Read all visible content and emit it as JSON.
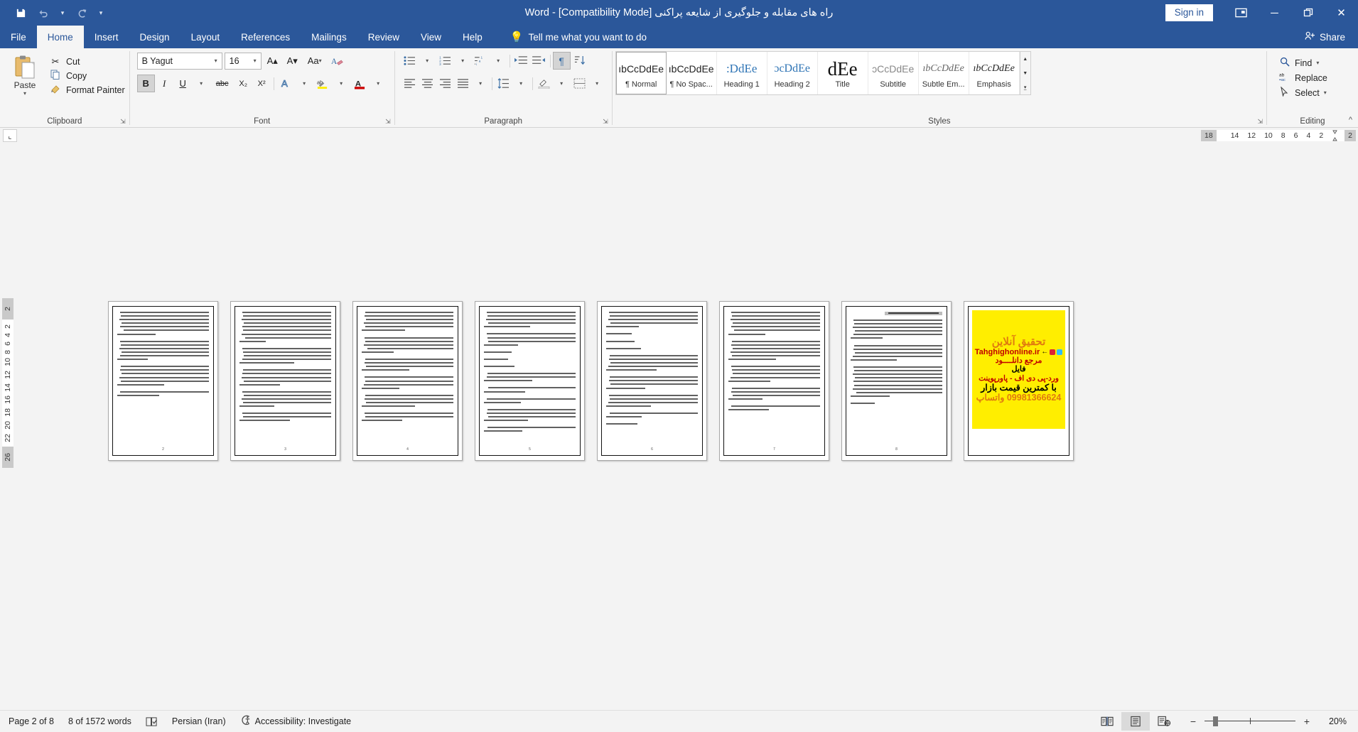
{
  "titlebar": {
    "document_title": "راه های مقابله و جلوگیری  از شایعه پراکنی [Compatibility Mode]  -  Word",
    "save_icon": "save-icon",
    "undo_icon": "undo-icon",
    "redo_icon": "redo-icon",
    "customize_icon": "customize-quick-access-toolbar-icon",
    "sign_in": "Sign in",
    "ribbon_display_icon": "ribbon-display-options-icon",
    "minimize": "─",
    "restore": "❐",
    "close": "✕"
  },
  "tabs": [
    {
      "label": "File",
      "active": false
    },
    {
      "label": "Home",
      "active": true
    },
    {
      "label": "Insert",
      "active": false
    },
    {
      "label": "Design",
      "active": false
    },
    {
      "label": "Layout",
      "active": false
    },
    {
      "label": "References",
      "active": false
    },
    {
      "label": "Mailings",
      "active": false
    },
    {
      "label": "Review",
      "active": false
    },
    {
      "label": "View",
      "active": false
    },
    {
      "label": "Help",
      "active": false
    }
  ],
  "tell_me": {
    "label": "Tell me what you want to do",
    "icon": "lightbulb-icon"
  },
  "share": {
    "label": "Share",
    "icon": "share-person-icon"
  },
  "ribbon": {
    "clipboard": {
      "group_label": "Clipboard",
      "paste_label": "Paste",
      "items": [
        {
          "label": "Cut",
          "icon": "scissors-icon"
        },
        {
          "label": "Copy",
          "icon": "copy-icon"
        },
        {
          "label": "Format Painter",
          "icon": "format-painter-icon"
        }
      ]
    },
    "font": {
      "group_label": "Font",
      "font_name": "B Yagut",
      "font_size": "16",
      "grow_font": "A▴",
      "shrink_font": "A▾",
      "change_case": "Aa",
      "clear_formatting": "clear-formatting-icon",
      "bold": "B",
      "italic": "I",
      "underline": "U",
      "strikethrough": "abc",
      "subscript": "X₂",
      "superscript": "X²",
      "text_effects": "A",
      "highlight": "ab",
      "font_color": "A"
    },
    "paragraph": {
      "group_label": "Paragraph",
      "bullets": "bullet-list-icon",
      "numbering": "numbered-list-icon",
      "multilevel": "multilevel-list-icon",
      "decrease_indent": "decrease-indent-icon",
      "increase_indent": "increase-indent-icon",
      "rtl_text": "right-to-left-text-icon",
      "sort": "sort-icon",
      "show_marks": "¶",
      "align_left": "align-left-icon",
      "align_center": "align-center-icon",
      "align_right": "align-right-icon",
      "justify": "justify-icon",
      "line_spacing": "line-spacing-icon",
      "shading": "shading-icon",
      "borders": "borders-icon"
    },
    "styles": {
      "group_label": "Styles",
      "items": [
        {
          "preview": "ıbCcDdEe",
          "name": "¶ Normal",
          "selected": true
        },
        {
          "preview": "ıbCcDdEe",
          "name": "¶ No Spac...",
          "selected": false
        },
        {
          "preview": ":DdEe",
          "name": "Heading 1",
          "selected": false
        },
        {
          "preview": "ɔcDdEe",
          "name": "Heading 2",
          "selected": false
        },
        {
          "preview": "dEe",
          "name": "Title",
          "selected": false
        },
        {
          "preview": "ɔCcDdEe",
          "name": "Subtitle",
          "selected": false
        },
        {
          "preview": "ıbCcDdEe",
          "name": "Subtle Em...",
          "selected": false
        },
        {
          "preview": "ıbCcDdEe",
          "name": "Emphasis",
          "selected": false
        }
      ]
    },
    "editing": {
      "group_label": "Editing",
      "items": [
        {
          "label": "Find",
          "icon": "magnifier-icon",
          "has_caret": true
        },
        {
          "label": "Replace",
          "icon": "replace-icon",
          "has_caret": false
        },
        {
          "label": "Select",
          "icon": "select-cursor-icon",
          "has_caret": true
        }
      ]
    },
    "collapse_icon": "collapse-ribbon-caret-icon"
  },
  "rulers": {
    "tab_stop_selector": "tab-stop-selector",
    "horizontal_grey_left": "18",
    "horizontal_numbers": [
      "14",
      "12",
      "10",
      "8",
      "6",
      "4",
      "2"
    ],
    "horizontal_grey_right": "2",
    "vertical_grey_top": "2",
    "vertical_numbers": [
      "2",
      "4",
      "6",
      "8",
      "10",
      "12",
      "14",
      "16",
      "18",
      "20",
      "22"
    ],
    "vertical_grey_bottom": "26"
  },
  "document": {
    "pages": [
      {
        "num": "2",
        "kind": "text",
        "heading": false,
        "paragraphs": [
          7,
          6,
          6
        ]
      },
      {
        "num": "3",
        "kind": "text",
        "heading": false,
        "paragraphs": [
          9,
          5,
          5,
          5,
          3
        ]
      },
      {
        "num": "4",
        "kind": "text",
        "heading": false,
        "paragraphs": [
          6,
          5,
          4,
          4,
          4,
          3
        ]
      },
      {
        "num": "5",
        "kind": "text",
        "heading": false,
        "paragraphs": [
          5,
          4,
          1,
          1,
          1,
          3,
          2,
          2,
          4,
          3
        ]
      },
      {
        "num": "6",
        "kind": "text",
        "heading": false,
        "paragraphs": [
          5,
          1,
          1,
          1,
          5,
          4,
          4,
          2,
          1
        ]
      },
      {
        "num": "7",
        "kind": "text",
        "heading": false,
        "paragraphs": [
          7,
          6,
          5,
          4,
          2
        ]
      },
      {
        "num": "8",
        "kind": "text",
        "heading": true,
        "paragraphs": [
          6,
          5,
          9,
          1
        ]
      },
      {
        "num": "",
        "kind": "ad"
      }
    ],
    "ad": {
      "line1": "تحقیق آنلاین",
      "line2": "Tahghighonline.ir",
      "line3": "مرجع دانلــــود",
      "line4": "فایل",
      "line5": "ورد-پی دی اف - پاورپوینت",
      "line6": "با کمترین قیمت بازار",
      "line7": "09981366624 واتساپ",
      "arrow": "←"
    }
  },
  "status": {
    "page": "Page 2 of 8",
    "words": "8 of 1572 words",
    "proofing_icon": "proofing-errors-icon",
    "language": "Persian (Iran)",
    "accessibility_icon": "accessibility-icon",
    "accessibility": "Accessibility: Investigate",
    "views": [
      {
        "name": "read-mode-view",
        "icon": "read-mode-icon",
        "active": false
      },
      {
        "name": "print-layout-view",
        "icon": "print-layout-icon",
        "active": true
      },
      {
        "name": "web-layout-view",
        "icon": "web-layout-icon",
        "active": false
      }
    ],
    "zoom_out": "−",
    "zoom_in": "+",
    "zoom_level": "20%"
  },
  "colors": {
    "brand": "#2b579a",
    "ribbon_bg": "#f5f5f5",
    "accent_text": "#2b579a",
    "ad_bg": "#ffee00",
    "ad_red": "#c00000",
    "ad_orange": "#e07a10"
  }
}
